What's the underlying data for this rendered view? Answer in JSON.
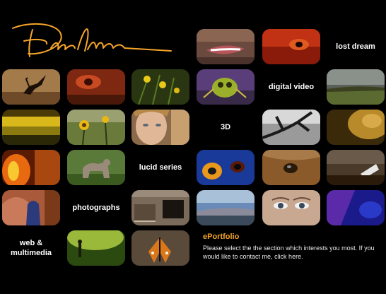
{
  "colors": {
    "background": "#000000",
    "logo": "#f7a52a",
    "eportfolio_title": "#f7a52a",
    "text": "#ffffff"
  },
  "nav": {
    "lost_dream": "lost dream",
    "digital_video": "digital video",
    "three_d": "3D",
    "lucid_series": "lucid series",
    "photographs": "photographs",
    "web_line1": "web &",
    "web_line2": "multimedia"
  },
  "eportfolio": {
    "title": "ePortfolio",
    "body": "Please select the the section which interests you most. If you would like to contact me, ",
    "link": "click here",
    "tail": "."
  },
  "thumbnails": [
    "lips",
    "red-eye",
    "lost-dream-end",
    "heron-silhouette",
    "red-texture",
    "yellow-flowers",
    "green-beetle",
    "wind-turbines-landscape",
    "yellow-field",
    "sunflowers",
    "woman-face",
    "dark-branches",
    "golden-gradient",
    "orange-glow",
    "dog-statue",
    "blue-eye-character",
    "horse-eye",
    "dark-figure",
    "blue-statue",
    "window-ruins",
    "landscape-sky",
    "face-eyes",
    "purple-abstract",
    "green-figure",
    "butterfly"
  ]
}
